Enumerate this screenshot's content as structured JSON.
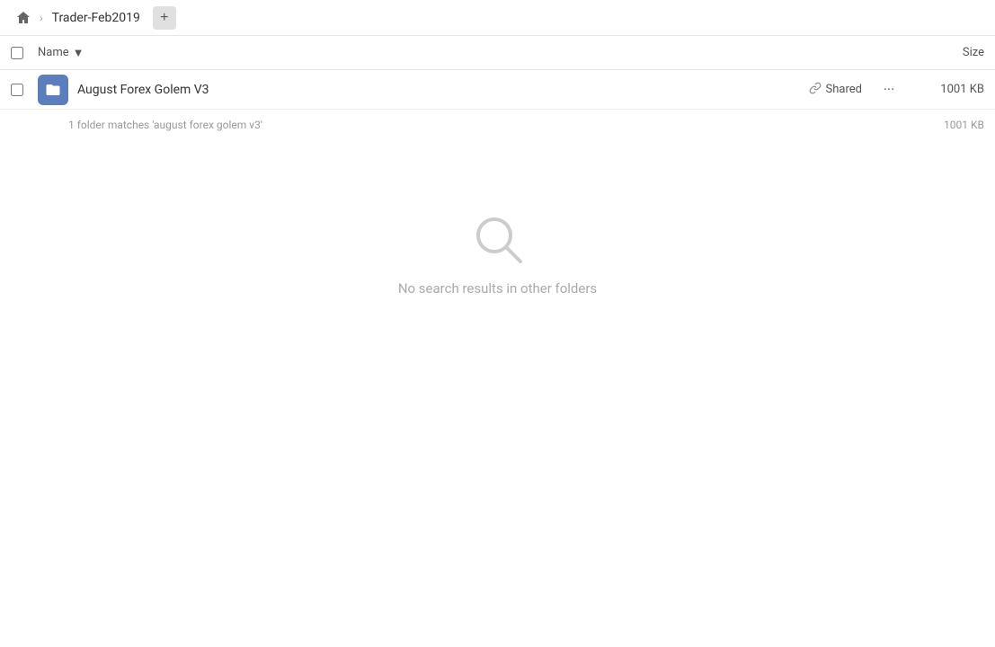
{
  "breadcrumb": {
    "home_label": "Home",
    "folder_label": "Trader-Feb2019",
    "add_button_label": "+"
  },
  "column_header": {
    "name_label": "Name",
    "sort_indicator": "▼",
    "size_label": "Size"
  },
  "file_row": {
    "name": "August Forex Golem V3",
    "shared_label": "Shared",
    "size": "1001 KB"
  },
  "summary": {
    "text": "1 folder matches 'august forex golem v3'",
    "size": "1001 KB"
  },
  "empty_state": {
    "message": "No search results in other folders"
  }
}
